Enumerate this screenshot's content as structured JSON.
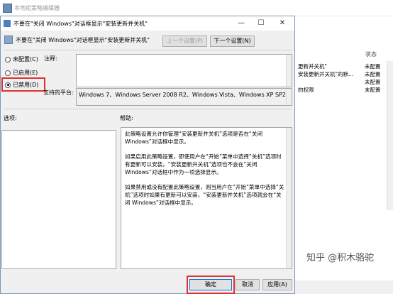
{
  "background_window": {
    "title": "本地组策略编辑器",
    "column_status": "状态",
    "rows": [
      {
        "name": "更新并关机\"",
        "status": "未配置"
      },
      {
        "name": "安装更新并关机\"的默...",
        "status": "未配置"
      },
      {
        "name": "",
        "status": "未配置"
      },
      {
        "name": "的权限",
        "status": "未配置"
      }
    ]
  },
  "dialog": {
    "title": "不要在\"关闭 Windows\"对话框显示\"安装更新并关机\"",
    "minimize": "—",
    "maximize": "☐",
    "close": "✕",
    "header_text": "不要在\"关闭 Windows\"对话框显示\"安装更新并关机\"",
    "prev_button": "上一个设置(P)",
    "next_button": "下一个设置(N)",
    "options": {
      "not_configured": "未配置(C)",
      "enabled": "已启用(E)",
      "disabled": "已禁用(D)",
      "selected": "disabled"
    },
    "comment_label": "注释:",
    "supported_label": "支持的平台:",
    "supported_value": "Windows 7、Windows Server 2008 R2、Windows Vista、Windows XP SP2",
    "options_label": "选项:",
    "help_label": "帮助:",
    "help_paragraphs": [
      "此策略设置允许你管理“安装更新并关机”选项是否在“关闭 Windows”对话框中显示。",
      "如果启用此策略设置，即使用户在“开始”菜单中选择“关机”选项时有更新可以安装，“安装更新并关机”选项也不会在“关闭 Windows”对话框中作为一项选择显示。",
      "如果禁用或没有配置此策略设置，则当用户在“开始”菜单中选择“关机”选项时如果有更新可以安装，“安装更新并关机”选项就会在“关闭 Windows”对话框中显示。"
    ],
    "ok_button": "确定",
    "cancel_button": "取消",
    "apply_button": "应用(A)"
  },
  "watermark": "知乎 @积木骆驼",
  "colors": {
    "highlight": "#e03030",
    "dialog_bg": "#f0f0f0",
    "dialog_border": "#7a98c0"
  }
}
